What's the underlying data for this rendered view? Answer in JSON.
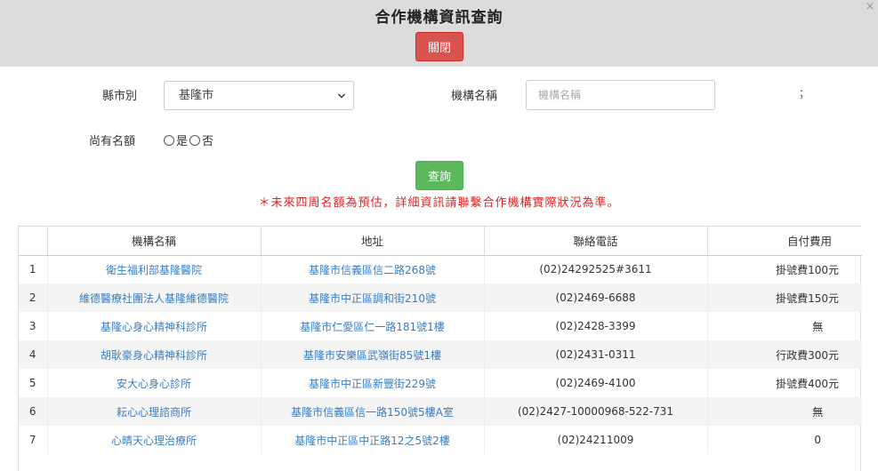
{
  "header": {
    "title": "合作機構資訊查詢",
    "close_button": "關閉",
    "close_x": "×"
  },
  "form": {
    "county_label": "縣市別",
    "county_value": "基隆市",
    "org_label": "機構名稱",
    "org_placeholder": "機構名稱",
    "stray_text": "；",
    "quota_label": "尚有名額",
    "quota_options": [
      "是",
      "否"
    ],
    "search_button": "查詢"
  },
  "notice": "＊未來四周名額為預估，詳細資訊請聯繫合作機構實際狀況為準。",
  "table": {
    "headers": [
      "",
      "機構名稱",
      "地址",
      "聯絡電話",
      "自付費用"
    ],
    "rows": [
      {
        "no": "1",
        "name": "衛生福利部基隆醫院",
        "address": "基隆市信義區信二路268號",
        "phone": "(02)24292525#3611",
        "fee": "掛號費100元"
      },
      {
        "no": "2",
        "name": "維德醫療社團法人基隆維德醫院",
        "address": "基隆市中正區調和街210號",
        "phone": "(02)2469-6688",
        "fee": "掛號費150元"
      },
      {
        "no": "3",
        "name": "基隆心身心精神科診所",
        "address": "基隆市仁愛區仁一路181號1樓",
        "phone": "(02)2428-3399",
        "fee": "無"
      },
      {
        "no": "4",
        "name": "胡耿豪身心精神科診所",
        "address": "基隆市安樂區武嶺街85號1樓",
        "phone": "(02)2431-0311",
        "fee": "行政費300元"
      },
      {
        "no": "5",
        "name": "安大心身心診所",
        "address": "基隆市中正區新豐街229號",
        "phone": "(02)2469-4100",
        "fee": "掛號費400元"
      },
      {
        "no": "6",
        "name": "耘心心理諮商所",
        "address": "基隆市信義區信一路150號5樓A室",
        "phone": "(02)2427-10000968-522-731",
        "fee": "無"
      },
      {
        "no": "7",
        "name": "心晴天心理治療所",
        "address": "基隆市中正區中正路12之5號2樓",
        "phone": "(02)24211009",
        "fee": "0"
      }
    ]
  }
}
